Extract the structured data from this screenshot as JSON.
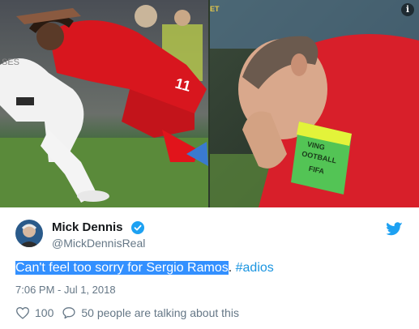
{
  "tweet": {
    "author_name": "Mick Dennis",
    "author_handle": "@MickDennisReal",
    "text_selected": "Can't feel too sorry for Sergio Ramos",
    "text_period": ".",
    "hashtag": "#adios",
    "timestamp": "7:06 PM - Jul 1, 2018",
    "likes": "100",
    "replies_text": "50 people are talking about this"
  },
  "media": {
    "left_photo": {
      "visible_text": [
        "11",
        "SES"
      ]
    },
    "right_photo": {
      "armband_text": [
        "VING",
        "OOTBALL",
        "FIFA"
      ]
    },
    "mark_left_edge": "ET"
  },
  "icons": {
    "info": "info-icon",
    "verified": "verified-badge-icon",
    "twitter": "twitter-bird-icon",
    "like": "heart-icon",
    "reply": "speech-bubble-icon"
  },
  "colors": {
    "accent": "#1da1f2",
    "selection": "#3390ff",
    "hashtag": "#1b95e0",
    "secondary_text": "#657786"
  }
}
